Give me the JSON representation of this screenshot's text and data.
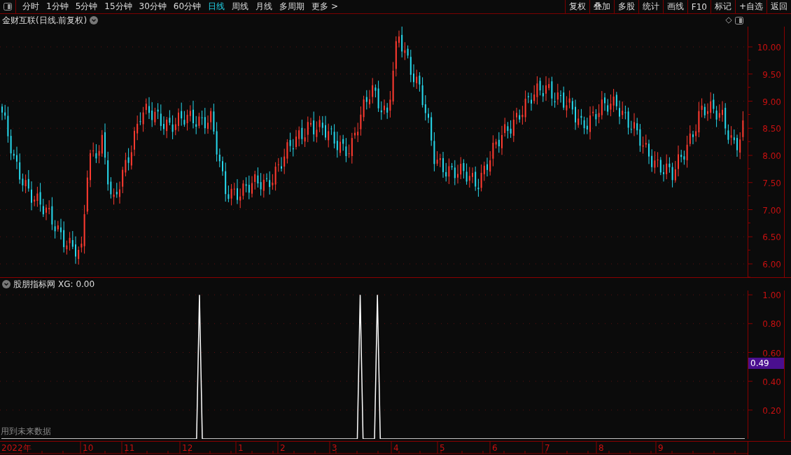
{
  "toolbar": {
    "periods": [
      {
        "label": "分时",
        "selected": false
      },
      {
        "label": "1分钟",
        "selected": false
      },
      {
        "label": "5分钟",
        "selected": false
      },
      {
        "label": "15分钟",
        "selected": false
      },
      {
        "label": "30分钟",
        "selected": false
      },
      {
        "label": "60分钟",
        "selected": false
      },
      {
        "label": "日线",
        "selected": true
      },
      {
        "label": "周线",
        "selected": false
      },
      {
        "label": "月线",
        "selected": false
      },
      {
        "label": "多周期",
        "selected": false
      },
      {
        "label": "更多 >",
        "selected": false
      }
    ],
    "actions": [
      "复权",
      "叠加",
      "多股",
      "统计",
      "画线",
      "F10",
      "标记",
      "+自选",
      "返回"
    ]
  },
  "price_panel": {
    "title": "金财互联(日线.前复权)",
    "price_ticks": [
      "10.00",
      "9.50",
      "9.00",
      "8.50",
      "8.00",
      "7.50",
      "7.00",
      "6.50",
      "6.00"
    ]
  },
  "indicator_panel": {
    "title": "股朋指标网",
    "reading": ": 0.00",
    "cursor_value": "0.49",
    "note": "用到未来数据",
    "chart_data": {
      "type": "line",
      "grid": true,
      "ylim": [
        0,
        1.03
      ],
      "yticks": [
        {
          "value": 0.2,
          "label": "0.20"
        },
        {
          "value": 0.4,
          "label": "0.40"
        },
        {
          "value": 0.6,
          "label": "0.60"
        },
        {
          "value": 0.8,
          "label": "0.80"
        },
        {
          "value": 1.0,
          "label": "1.00"
        }
      ],
      "series": [
        {
          "name": "XG",
          "color": "#ffffff",
          "values": [
            0,
            0,
            0,
            0,
            0,
            0,
            0,
            0,
            0,
            0,
            0,
            0,
            0,
            0,
            0,
            0,
            0,
            0,
            0,
            0,
            0,
            0,
            0,
            0,
            0,
            0,
            0,
            0,
            0,
            0,
            0,
            0,
            0,
            0,
            0,
            0,
            0,
            0,
            0,
            0,
            0,
            0,
            0,
            0,
            0,
            0,
            0,
            0,
            0,
            0,
            0,
            0,
            0,
            0,
            0,
            0,
            0,
            0,
            0,
            0,
            0,
            0,
            0,
            0,
            0,
            0,
            0,
            0,
            0,
            1,
            0,
            0,
            0,
            0,
            0,
            0,
            0,
            0,
            0,
            0,
            0,
            0,
            0,
            0,
            0,
            0,
            0,
            0,
            0,
            0,
            0,
            0,
            0,
            0,
            0,
            0,
            0,
            0,
            0,
            0,
            0,
            0,
            0,
            0,
            0,
            0,
            0,
            0,
            0,
            0,
            0,
            0,
            0,
            0,
            0,
            0,
            0,
            0,
            0,
            0,
            0,
            0,
            0,
            0,
            0,
            1,
            0,
            0,
            0,
            0,
            0,
            1,
            0,
            0,
            0,
            0,
            0,
            0,
            0,
            0,
            0,
            0,
            0,
            0,
            0,
            0,
            0,
            0,
            0,
            0,
            0,
            0,
            0,
            0,
            0,
            0,
            0,
            0,
            0,
            0,
            0,
            0,
            0,
            0,
            0,
            0,
            0,
            0,
            0,
            0,
            0,
            0,
            0,
            0,
            0,
            0,
            0,
            0,
            0,
            0,
            0,
            0,
            0,
            0,
            0,
            0,
            0,
            0,
            0,
            0,
            0,
            0,
            0,
            0,
            0,
            0,
            0,
            0,
            0,
            0,
            0,
            0,
            0,
            0,
            0,
            0,
            0,
            0,
            0,
            0,
            0,
            0,
            0,
            0,
            0,
            0,
            0,
            0,
            0,
            0,
            0,
            0,
            0,
            0,
            0,
            0,
            0,
            0,
            0,
            0,
            0,
            0,
            0,
            0,
            0,
            0,
            0,
            0,
            0,
            0,
            0,
            0,
            0,
            0,
            0,
            0,
            0,
            0,
            0,
            0,
            0,
            0,
            0,
            0,
            0,
            0,
            0,
            0,
            0,
            0
          ]
        }
      ]
    }
  },
  "date_axis": [
    "2022年",
    "10",
    "11",
    "12",
    "1",
    "2",
    "3",
    "4",
    "5",
    "6",
    "7",
    "8",
    "9"
  ]
}
